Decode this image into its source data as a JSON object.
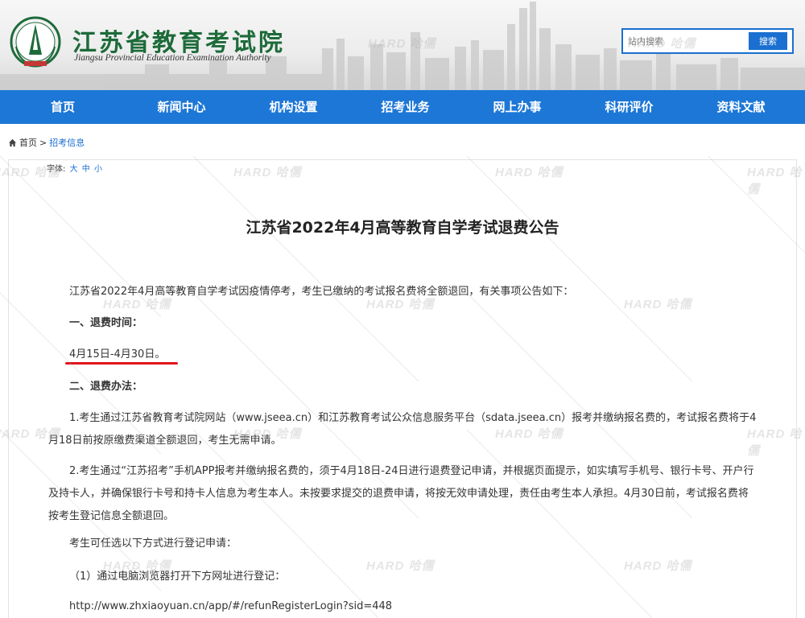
{
  "header": {
    "site_title": "江苏省教育考试院",
    "site_subtitle": "Jiangsu Provincial Education Examination Authority",
    "logo_icon": "exam-authority-emblem",
    "search": {
      "placeholder": "站内搜索",
      "button_label": "搜索"
    }
  },
  "nav": {
    "items": [
      "首页",
      "新闻中心",
      "机构设置",
      "招考业务",
      "网上办事",
      "科研评价",
      "资料文献"
    ]
  },
  "breadcrumb": {
    "home": "首页",
    "separator": ">",
    "current": "招考信息"
  },
  "font_size_control": {
    "label": "字体:",
    "large": "大",
    "medium": "中",
    "small": "小"
  },
  "article": {
    "title": "江苏省2022年4月高等教育自学考试退费公告",
    "intro": "江苏省2022年4月高等教育自学考试因疫情停考，考生已缴纳的考试报名费将全额退回，有关事项公告如下：",
    "section1_heading": "一、退费时间：",
    "section1_body": "4月15日-4月30日。",
    "section2_heading": "二、退费办法：",
    "item1": "1.考生通过江苏省教育考试院网站（www.jseea.cn）和江苏教育考试公众信息服务平台（sdata.jseea.cn）报考并缴纳报名费的，考试报名费将于4月18日前按原缴费渠道全额退回，考生无需申请。",
    "item2": "2.考生通过“江苏招考”手机APP报考并缴纳报名费的，须于4月18日-24日进行退费登记申请，并根据页面提示，如实填写手机号、银行卡号、开户行及持卡人，并确保银行卡号和持卡人信息为考生本人。未按要求提交的退费申请，将按无效申请处理，责任由考生本人承担。4月30日前，考试报名费将按考生登记信息全额退回。",
    "options_intro": "考生可任选以下方式进行登记申请：",
    "option1": "（1）通过电脑浏览器打开下方网址进行登记：",
    "url": "http://www.zhxiaoyuan.cn/app/#/refunRegisterLogin?sid=448"
  },
  "watermark": "HARD 哈儒",
  "colors": {
    "nav_bg": "#1d77d6",
    "accent": "#1a6fd0",
    "highlight_underline": "#e0141c",
    "logo_green": "#1d6b3a"
  }
}
